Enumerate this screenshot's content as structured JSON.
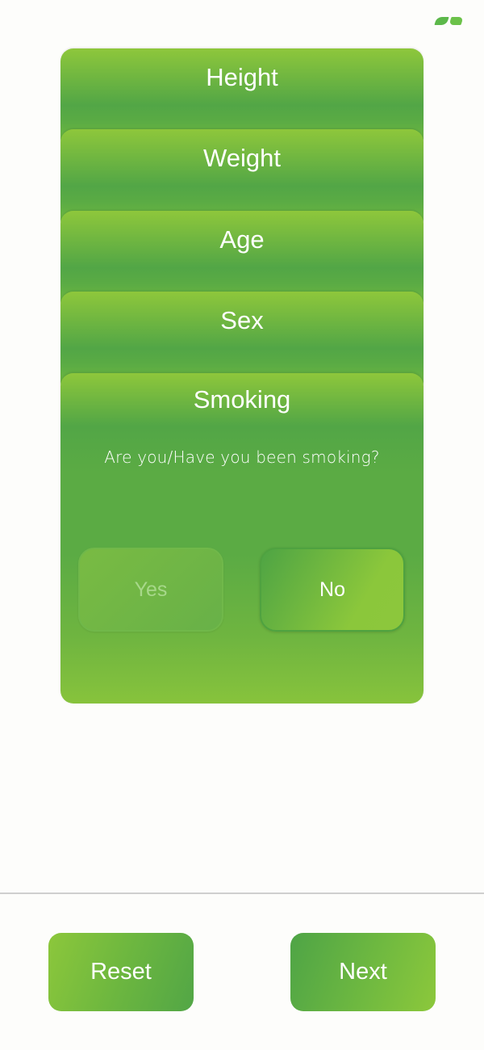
{
  "brand": {
    "logo_icon": "leaf-logo-icon",
    "accent_color": "#52a646",
    "accent_light": "#8ec73b"
  },
  "cards": {
    "height": {
      "title": "Height"
    },
    "weight": {
      "title": "Weight"
    },
    "age": {
      "title": "Age"
    },
    "sex": {
      "title": "Sex"
    },
    "smoking": {
      "title": "Smoking",
      "question": "Are you/Have you been smoking?",
      "yes_label": "Yes",
      "no_label": "No"
    }
  },
  "footer": {
    "reset_label": "Reset",
    "next_label": "Next"
  }
}
